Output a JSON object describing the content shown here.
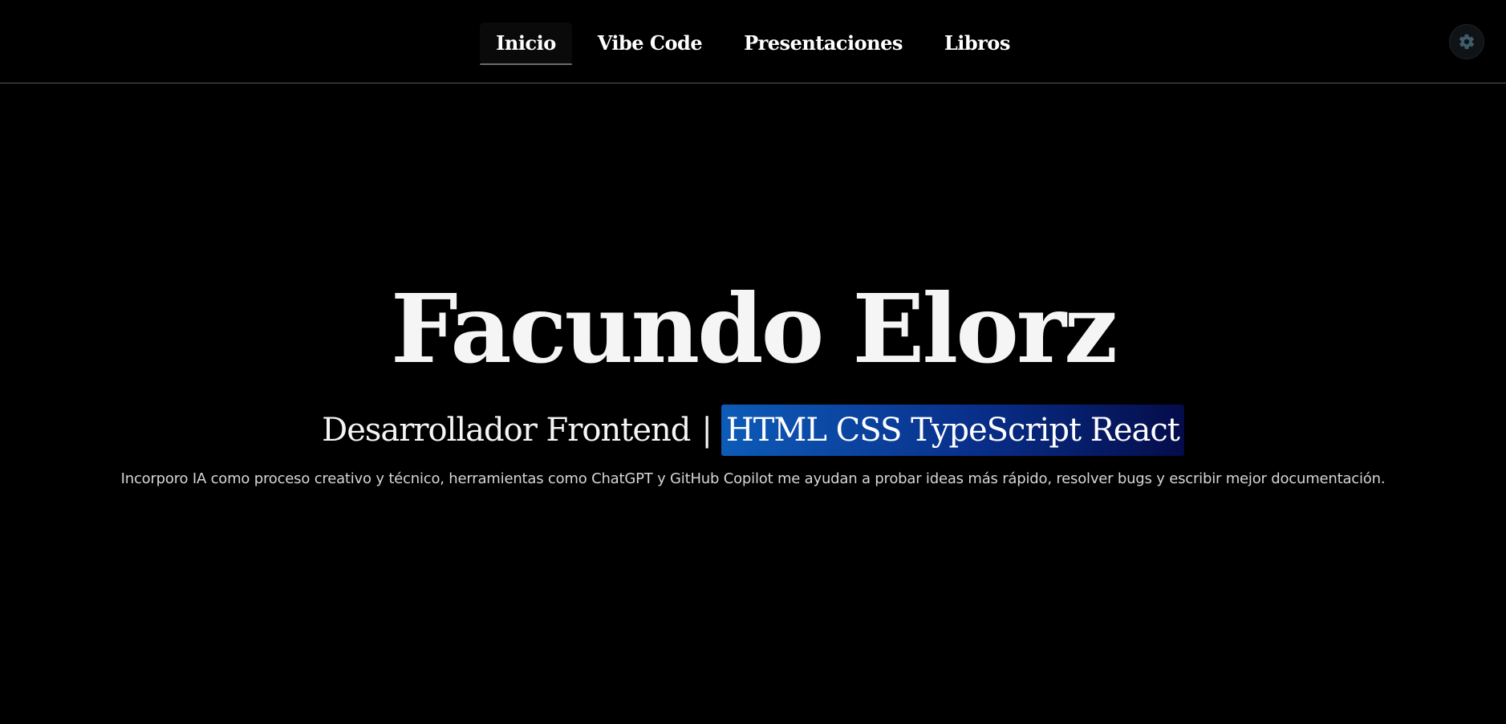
{
  "nav": {
    "items": [
      {
        "label": "Inicio",
        "active": true
      },
      {
        "label": "Vibe Code",
        "active": false
      },
      {
        "label": "Presentaciones",
        "active": false
      },
      {
        "label": "Libros",
        "active": false
      }
    ],
    "theme_toggle_icon": "gear-icon",
    "theme_toggle_color": "#3f5d6b"
  },
  "hero": {
    "name": "Facundo Elorz",
    "role": "Desarrollador Frontend",
    "separator": "|",
    "stack": "HTML CSS TypeScript React",
    "description": "Incorporo IA como proceso creativo y técnico, herramientas como ChatGPT y GitHub Copilot me ayudan a probar ideas más rápido, resolver bugs y escribir mejor documentación."
  },
  "colors": {
    "background": "#000000",
    "text": "#f5f5f5",
    "highlight_start": "#0d5bb8",
    "highlight_end": "#050c4a"
  }
}
